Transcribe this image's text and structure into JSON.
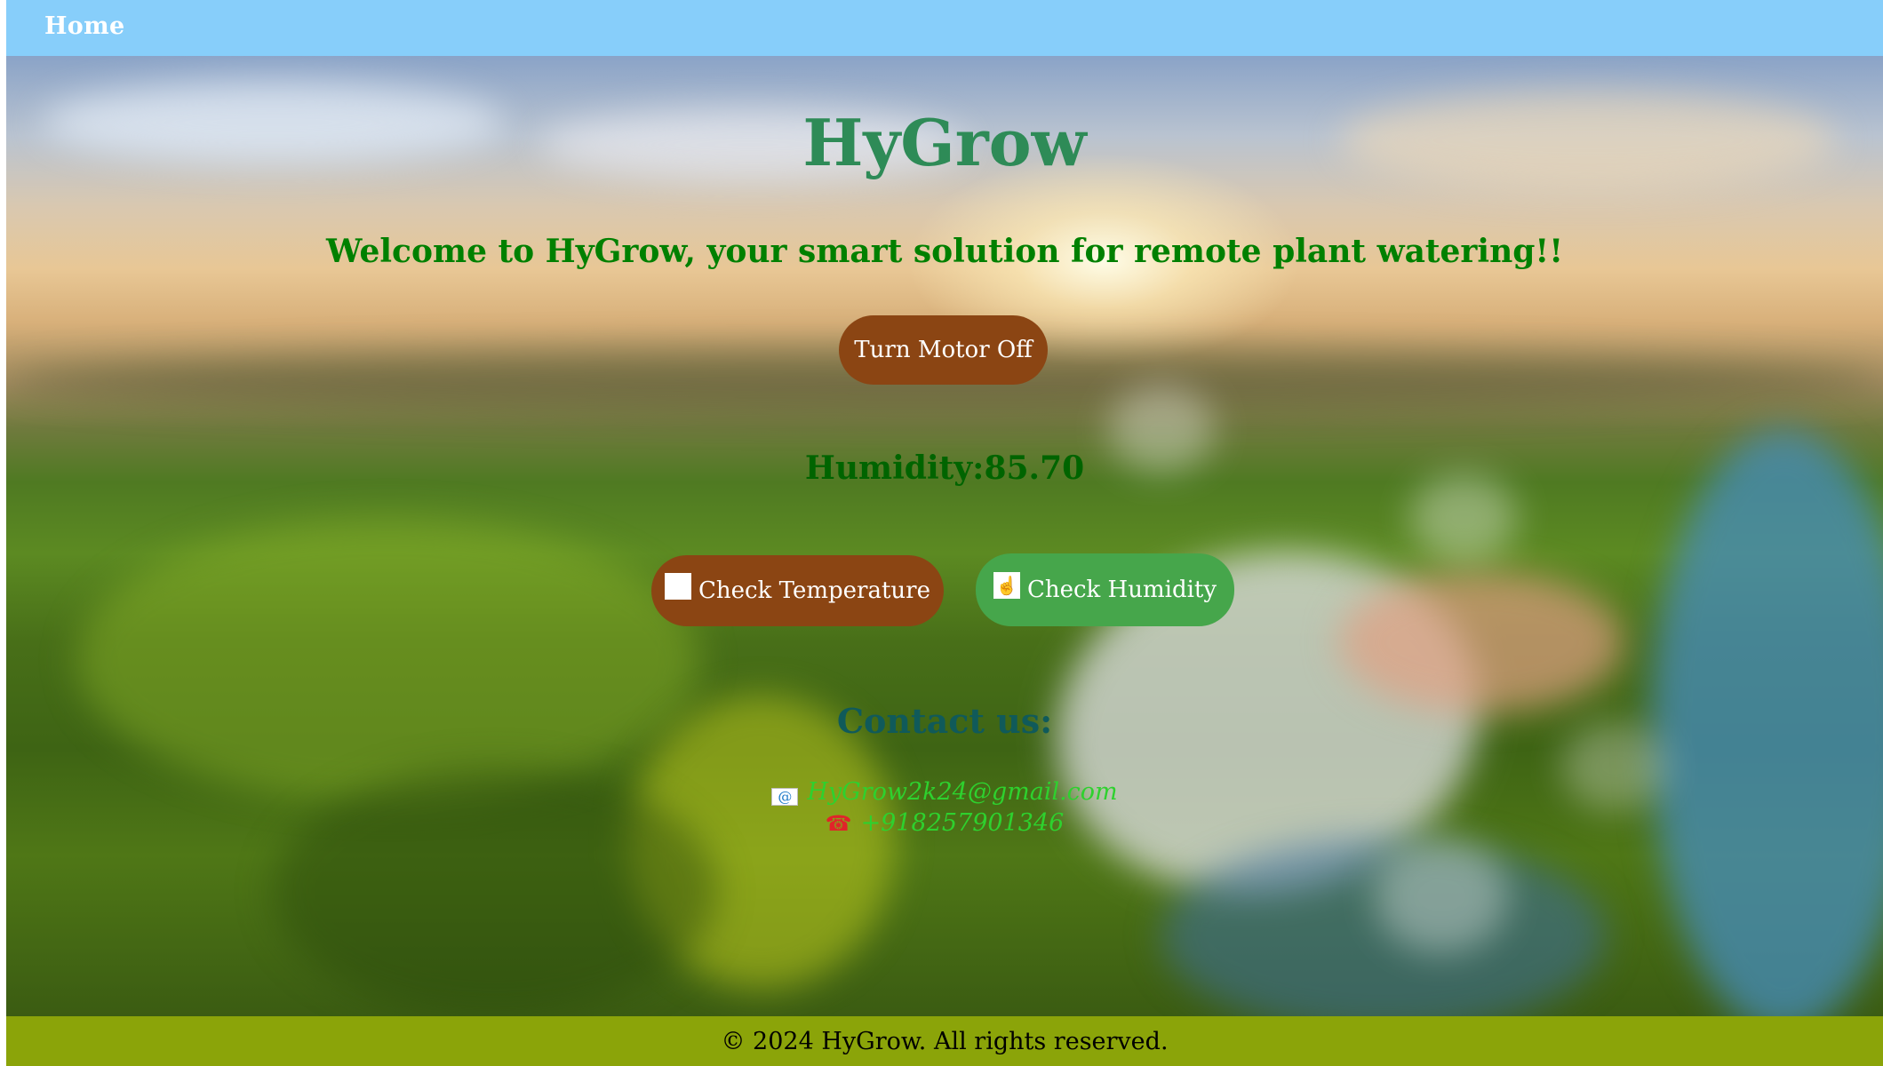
{
  "nav": {
    "home_label": "Home"
  },
  "hero": {
    "title": "HyGrow",
    "welcome": "Welcome to HyGrow, your smart solution for remote plant watering!!"
  },
  "controls": {
    "motor_button_label": "Turn Motor Off",
    "reading_text": "Humidity:85.70",
    "temperature_button_label": "Check Temperature",
    "humidity_button_label": "Check Humidity"
  },
  "contact": {
    "heading": "Contact us:",
    "email": "HyGrow2k24@gmail.com",
    "phone": "+918257901346"
  },
  "footer": {
    "text": "© 2024 HyGrow. All rights reserved."
  },
  "colors": {
    "navbar": "#87cefa",
    "title": "#2e8b57",
    "welcome": "#008000",
    "motor_button": "#8b4513",
    "temperature_button": "#8b4513",
    "humidity_button": "#46a64b",
    "contact_heading": "#105a5a",
    "contact_links": "#2ed12e",
    "footer": "#8ba409"
  },
  "icons": {
    "temperature": "thermometer-icon",
    "humidity": "hand-icon",
    "email": "email-icon",
    "phone": "phone-icon"
  }
}
